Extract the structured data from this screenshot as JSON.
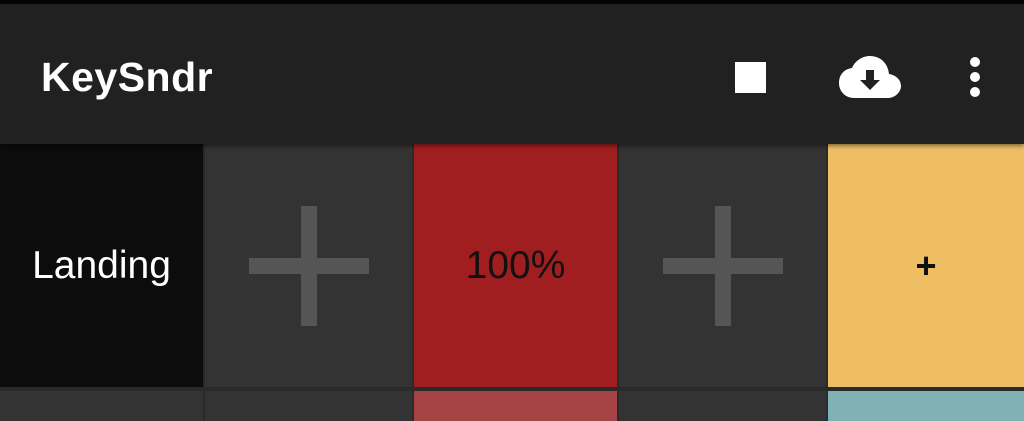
{
  "app_bar": {
    "title": "KeySndr",
    "actions": [
      "stop-icon",
      "cloud-download-icon",
      "more-vert-icon"
    ]
  },
  "tiles_row1": [
    {
      "label": "Landing",
      "color": "#0c0c0c",
      "text_color": "#ffffff"
    },
    {
      "label": "",
      "icon": "add-icon",
      "color": "#333333"
    },
    {
      "label": "100%",
      "color": "#a01e20",
      "text_color": "#111111"
    },
    {
      "label": "",
      "icon": "add-icon",
      "color": "#333333"
    },
    {
      "label": "+",
      "color": "#efbd63",
      "text_color": "#111111"
    }
  ],
  "tiles_row2_colors": [
    "#333333",
    "#333333",
    "#a44244",
    "#333333",
    "#80b2b5"
  ],
  "colors": {
    "app_bar": "#212121",
    "grid_background": "#2a2a2a"
  }
}
